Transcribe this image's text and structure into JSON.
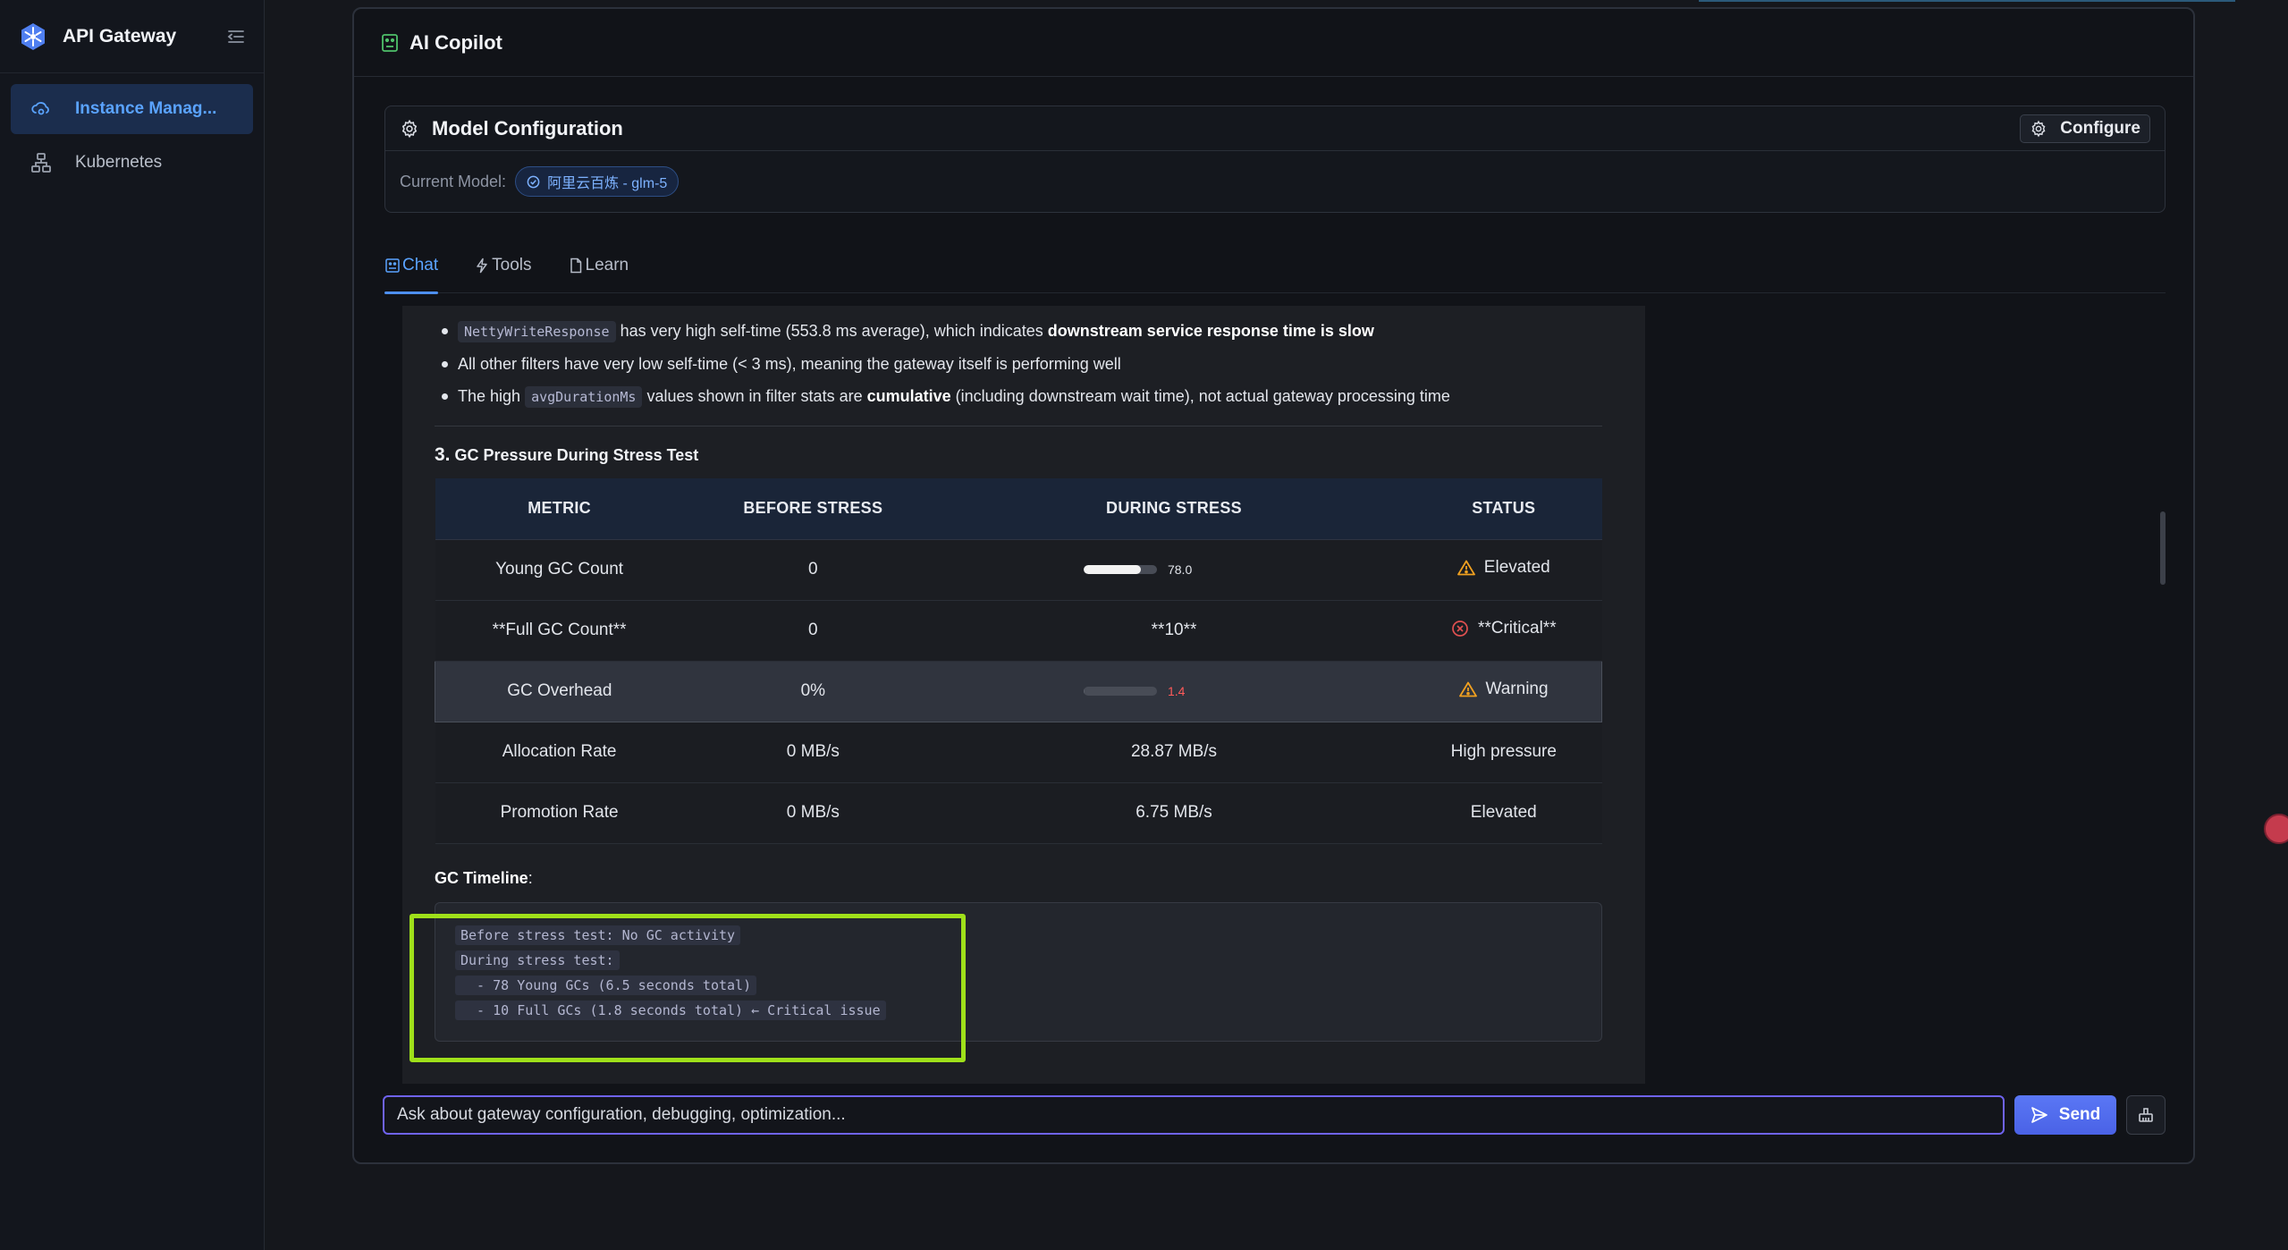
{
  "app": {
    "title": "API Gateway"
  },
  "sidebar": {
    "items": [
      {
        "label": "Instance Manag...",
        "active": true,
        "icon": "cloud-gear-icon"
      },
      {
        "label": "Kubernetes",
        "active": false,
        "icon": "cluster-icon"
      }
    ]
  },
  "panel": {
    "title": "AI Copilot"
  },
  "model_config": {
    "title": "Model Configuration",
    "configure_label": "Configure",
    "current_model_label": "Current Model:",
    "current_model_value": "阿里云百炼 - glm-5"
  },
  "tabs": [
    {
      "label": "Chat",
      "active": true
    },
    {
      "label": "Tools",
      "active": false
    },
    {
      "label": "Learn",
      "active": false
    }
  ],
  "message": {
    "bullets": [
      {
        "code": "NettyWriteResponse",
        "text": " has very high self-time (553.8 ms average), which indicates ",
        "bold": "downstream service response time is slow",
        "tail": ""
      },
      {
        "code": "",
        "text": "All other filters have very low self-time (< 3 ms), meaning the gateway itself is performing well",
        "bold": "",
        "tail": ""
      },
      {
        "pre": "The high ",
        "code": "avgDurationMs",
        "text": " values shown in filter stats are ",
        "bold": "cumulative",
        "tail": " (including downstream wait time), not actual gateway processing time"
      }
    ],
    "section_num": "3.",
    "section_title": "GC Pressure During Stress Test",
    "table": {
      "headers": [
        "METRIC",
        "BEFORE STRESS",
        "DURING STRESS",
        "STATUS"
      ],
      "rows": [
        {
          "metric": "Young GC Count",
          "before": "0",
          "during_bar": 0.78,
          "during_label": "78.0",
          "status": "Elevated",
          "status_icon": "warning-icon"
        },
        {
          "metric": "**Full GC Count**",
          "before": "0",
          "during_text": "**10**",
          "status": "**Critical**",
          "status_icon": "error-circle-icon"
        },
        {
          "metric": "GC Overhead",
          "before": "0%",
          "during_bar": 0.014,
          "during_label": "1.4",
          "status": "Warning",
          "status_icon": "warning-icon"
        },
        {
          "metric": "Allocation Rate",
          "before": "0 MB/s",
          "during_text": "28.87 MB/s",
          "status": "High pressure"
        },
        {
          "metric": "Promotion Rate",
          "before": "0 MB/s",
          "during_text": "6.75 MB/s",
          "status": "Elevated"
        }
      ]
    },
    "timeline_label": "GC Timeline",
    "timeline_colon": ":",
    "code_lines": [
      "Before stress test: No GC activity",
      "During stress test:",
      "  - 78 Young GCs (6.5 seconds total)",
      "  - 10 Full GCs (1.8 seconds total) ← Critical issue"
    ]
  },
  "input": {
    "placeholder": "Ask about gateway configuration, debugging, optimization...",
    "value": ""
  },
  "send_label": "Send",
  "colors": {
    "accent": "#5aa3ff",
    "warning": "#f0a020",
    "error": "#e05050",
    "highlight": "#9fe01a",
    "send": "#4f69ec"
  }
}
